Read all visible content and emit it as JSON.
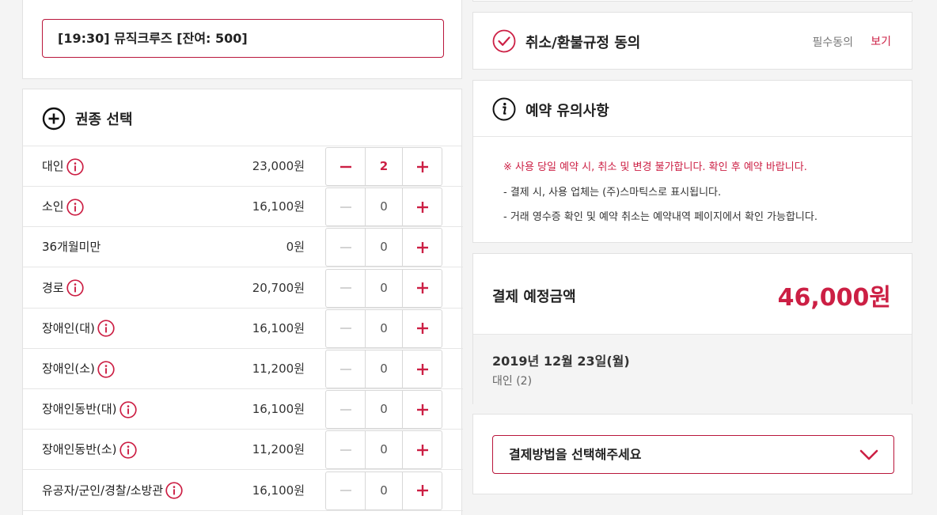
{
  "schedule": {
    "selected": "[19:30] 뮤직크루즈 [잔여: 500]"
  },
  "tickets": {
    "title": "권종 선택",
    "rows": [
      {
        "label": "대인",
        "info": true,
        "price": "23,000원",
        "qty": "2",
        "minus_enabled": true
      },
      {
        "label": "소인",
        "info": true,
        "price": "16,100원",
        "qty": "0",
        "minus_enabled": false
      },
      {
        "label": "36개월미만",
        "info": false,
        "price": "0원",
        "qty": "0",
        "minus_enabled": false
      },
      {
        "label": "경로",
        "info": true,
        "price": "20,700원",
        "qty": "0",
        "minus_enabled": false
      },
      {
        "label": "장애인(대)",
        "info": true,
        "price": "16,100원",
        "qty": "0",
        "minus_enabled": false
      },
      {
        "label": "장애인(소)",
        "info": true,
        "price": "11,200원",
        "qty": "0",
        "minus_enabled": false
      },
      {
        "label": "장애인동반(대)",
        "info": true,
        "price": "16,100원",
        "qty": "0",
        "minus_enabled": false
      },
      {
        "label": "장애인동반(소)",
        "info": true,
        "price": "11,200원",
        "qty": "0",
        "minus_enabled": false
      },
      {
        "label": "유공자/군인/경찰/소방관",
        "info": true,
        "price": "16,100원",
        "qty": "0",
        "minus_enabled": false
      }
    ]
  },
  "agreement": {
    "title": "취소/환불규정 동의",
    "required": "필수동의",
    "view": "보기"
  },
  "notice": {
    "title": "예약 유의사항",
    "warning": "※ 사용 당일 예약 시, 취소 및 변경 불가합니다. 확인 후 예약 바랍니다.",
    "lines": [
      "- 결제 시, 사용 업체는 (주)스마틱스로 표시됩니다.",
      "- 거래 영수증 확인 및 예약 취소는 예약내역 페이지에서 확인 가능합니다."
    ]
  },
  "payment": {
    "label": "결제 예정금액",
    "amount": "46,000원",
    "date": "2019년 12월 23일(월)",
    "detail": "대인 (2)"
  },
  "method": {
    "placeholder": "결제방법을 선택해주세요"
  },
  "colors": {
    "accent": "#cc1f44",
    "disabled": "#c8c8c8"
  }
}
